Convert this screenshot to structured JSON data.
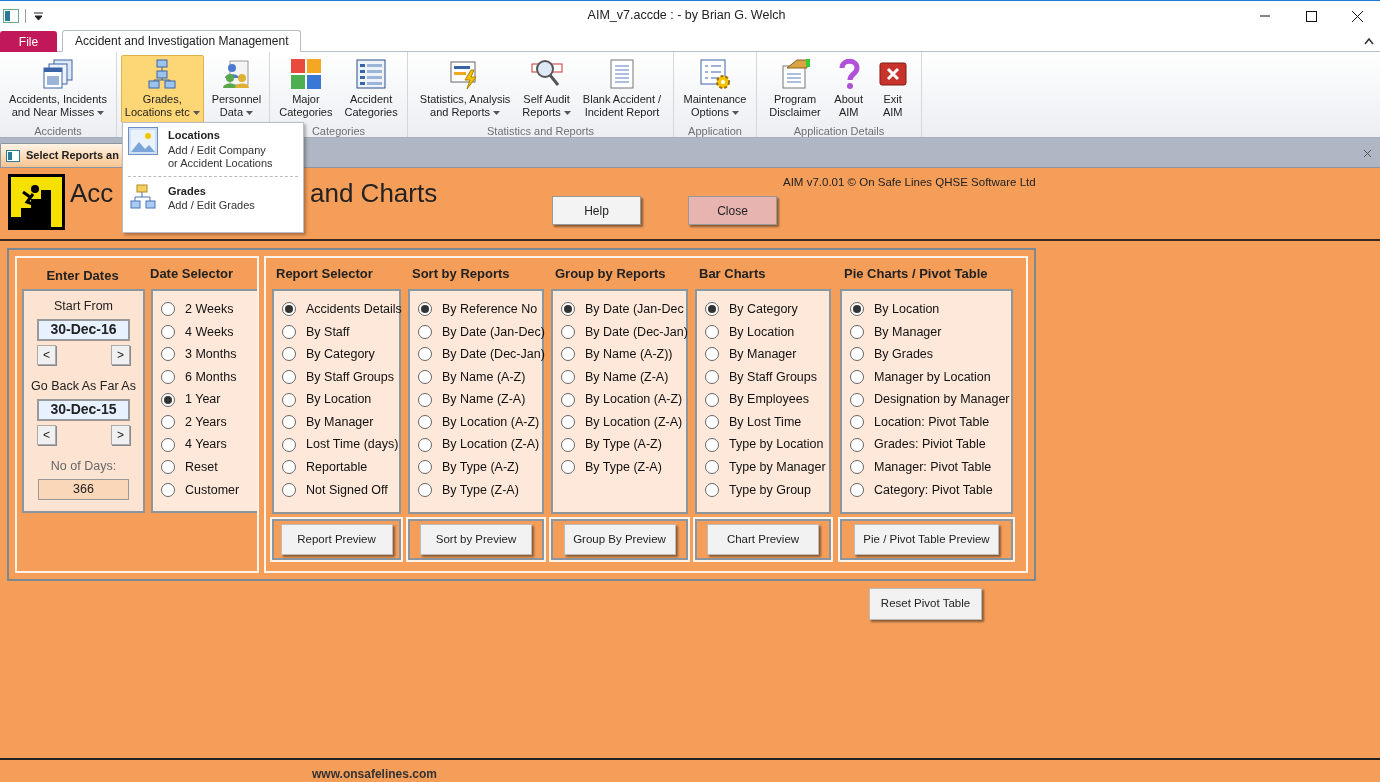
{
  "window": {
    "title": "AIM_v7.accde :  - by Brian G. Welch"
  },
  "ribbon": {
    "file_tab": "File",
    "tabs": [
      {
        "label": "Accident and Investigation Management",
        "selected": true
      }
    ],
    "groups": [
      {
        "label": "Accidents",
        "buttons": [
          {
            "label": "Accidents, Incidents\nand Near Misses",
            "dropdown": true,
            "selected": false
          }
        ]
      },
      {
        "buttons": [
          {
            "label": "Grades,\nLocations etc",
            "dropdown": true,
            "selected": true
          },
          {
            "label": "Personnel\nData",
            "dropdown": true,
            "selected": false
          }
        ]
      },
      {
        "label": "Categories",
        "buttons": [
          {
            "label": "Major\nCategories",
            "dropdown": false,
            "selected": false
          },
          {
            "label": "Accident\nCategories",
            "dropdown": false,
            "selected": false
          }
        ]
      },
      {
        "label": "Statistics and Reports",
        "buttons": [
          {
            "label": "Statistics, Analysis\nand Reports",
            "dropdown": true,
            "selected": false
          },
          {
            "label": "Self Audit\nReports",
            "dropdown": true,
            "selected": false
          },
          {
            "label": "Blank Accident /\nIncident Report",
            "dropdown": false,
            "selected": false
          }
        ]
      },
      {
        "label": "Application",
        "buttons": [
          {
            "label": "Maintenance\nOptions",
            "dropdown": true,
            "selected": false
          }
        ]
      },
      {
        "label": "Application Details",
        "buttons": [
          {
            "label": "Program\nDisclaimer",
            "dropdown": false,
            "selected": false
          },
          {
            "label": "About\nAIM",
            "dropdown": false,
            "selected": false
          },
          {
            "label": "Exit\nAIM",
            "dropdown": false,
            "selected": false
          }
        ]
      }
    ]
  },
  "dropdown_menu": {
    "items": [
      {
        "title": "Locations",
        "description": "Add / Edit Company\nor Accident Locations"
      },
      {
        "title": "Grades",
        "description": "Add / Edit Grades"
      }
    ]
  },
  "form_tab": {
    "label": "Select Reports an"
  },
  "header": {
    "title_start": "Acc",
    "title_end": "and Charts",
    "version": "AIM v7.0.01 © On Safe Lines QHSE Software Ltd",
    "buttons": [
      {
        "label": "Help",
        "kind": "help"
      },
      {
        "label": "Close",
        "kind": "close"
      }
    ]
  },
  "dates": {
    "heading": "Enter Dates",
    "start_label": "Start From",
    "start_value": "30-Dec-16",
    "start_prev": "<",
    "start_next": ">",
    "back_label": "Go Back As Far As",
    "back_value": "30-Dec-15",
    "back_prev": "<",
    "back_next": ">",
    "days_label": "No of Days:",
    "days_value": "366"
  },
  "date_selector": {
    "heading": "Date Selector",
    "options": [
      {
        "label": "2  Weeks",
        "selected": false
      },
      {
        "label": "4  Weeks",
        "selected": false
      },
      {
        "label": "3 Months",
        "selected": false
      },
      {
        "label": "6 Months",
        "selected": false
      },
      {
        "label": "1 Year",
        "selected": true
      },
      {
        "label": "2 Years",
        "selected": false
      },
      {
        "label": "4 Years",
        "selected": false
      },
      {
        "label": "Reset",
        "selected": false
      },
      {
        "label": "Customer",
        "selected": false
      }
    ]
  },
  "report_groups": [
    {
      "heading": "Report Selector",
      "preview_button": "Report Preview",
      "options": [
        {
          "label": "Accidents Details",
          "selected": true
        },
        {
          "label": "By Staff",
          "selected": false
        },
        {
          "label": "By Category",
          "selected": false
        },
        {
          "label": "By Staff Groups",
          "selected": false
        },
        {
          "label": "By Location",
          "selected": false
        },
        {
          "label": "By Manager",
          "selected": false
        },
        {
          "label": "Lost Time (days)",
          "selected": false
        },
        {
          "label": "Reportable",
          "selected": false
        },
        {
          "label": "Not Signed Off",
          "selected": false
        }
      ]
    },
    {
      "heading": "Sort by Reports",
      "preview_button": "Sort by Preview",
      "options": [
        {
          "label": "By Reference No",
          "selected": true
        },
        {
          "label": "By Date (Jan-Dec)",
          "selected": false
        },
        {
          "label": "By Date (Dec-Jan)",
          "selected": false
        },
        {
          "label": "By Name (A-Z)",
          "selected": false
        },
        {
          "label": "By Name (Z-A)",
          "selected": false
        },
        {
          "label": "By Location (A-Z)",
          "selected": false
        },
        {
          "label": "By Location (Z-A)",
          "selected": false
        },
        {
          "label": "By Type (A-Z)",
          "selected": false
        },
        {
          "label": "By Type (Z-A)",
          "selected": false
        }
      ]
    },
    {
      "heading": "Group by Reports",
      "preview_button": "Group By Preview",
      "options": [
        {
          "label": "By Date (Jan-Dec",
          "selected": true
        },
        {
          "label": "By Date (Dec-Jan)",
          "selected": false
        },
        {
          "label": "By Name (A-Z))",
          "selected": false
        },
        {
          "label": "By Name (Z-A)",
          "selected": false
        },
        {
          "label": "By Location (A-Z)",
          "selected": false
        },
        {
          "label": "By Location (Z-A)",
          "selected": false
        },
        {
          "label": "By Type (A-Z)",
          "selected": false
        },
        {
          "label": "By Type (Z-A)",
          "selected": false
        }
      ]
    },
    {
      "heading": "Bar Charts",
      "preview_button": "Chart Preview",
      "options": [
        {
          "label": "By Category",
          "selected": true
        },
        {
          "label": "By Location",
          "selected": false
        },
        {
          "label": "By Manager",
          "selected": false
        },
        {
          "label": "By Staff Groups",
          "selected": false
        },
        {
          "label": "By Employees",
          "selected": false
        },
        {
          "label": "By Lost Time",
          "selected": false
        },
        {
          "label": "Type by Location",
          "selected": false
        },
        {
          "label": "Type by Manager",
          "selected": false
        },
        {
          "label": "Type by Group",
          "selected": false
        }
      ]
    },
    {
      "heading": "Pie Charts / Pivot Table",
      "preview_button": "Pie / Pivot Table  Preview",
      "options": [
        {
          "label": "By Location",
          "selected": true
        },
        {
          "label": "By Manager",
          "selected": false
        },
        {
          "label": "By Grades",
          "selected": false
        },
        {
          "label": "Manager by Location",
          "selected": false
        },
        {
          "label": "Designation by Manager",
          "selected": false
        },
        {
          "label": "Location: Pivot Table",
          "selected": false
        },
        {
          "label": "Grades: Piviot Table",
          "selected": false
        },
        {
          "label": "Manager: Pivot Table",
          "selected": false
        },
        {
          "label": "Category: Pivot Table",
          "selected": false
        }
      ]
    }
  ],
  "reset_button": "Reset Pivot Table",
  "footer": {
    "website": "www.onsafelines.com"
  }
}
